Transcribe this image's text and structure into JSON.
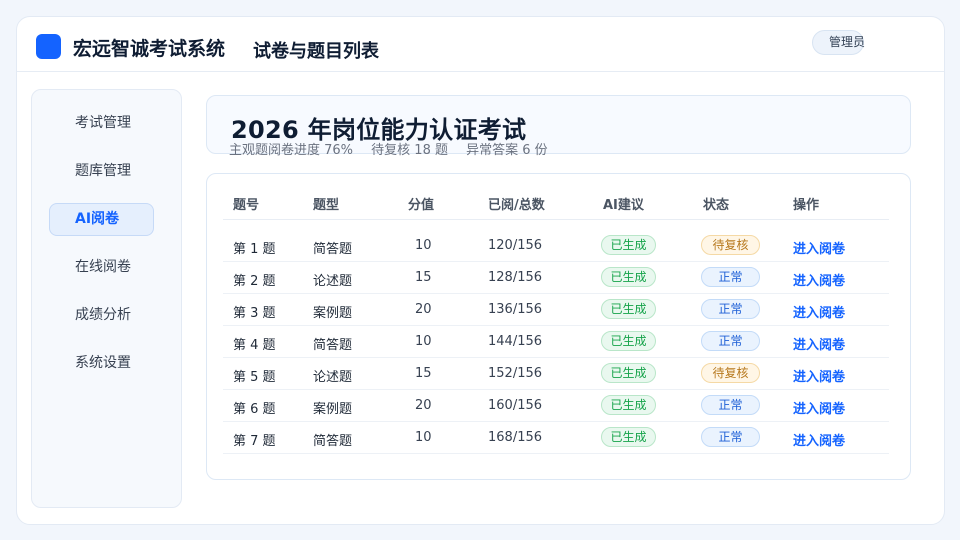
{
  "app": {
    "name": "宏远智诚考试系统",
    "page_title": "试卷与题目列表",
    "user_role": "管理员",
    "brand_color": "#1463ff"
  },
  "sidebar": {
    "items": [
      {
        "label": "考试管理",
        "active": false
      },
      {
        "label": "题库管理",
        "active": false
      },
      {
        "label": "AI阅卷",
        "active": true
      },
      {
        "label": "在线阅卷",
        "active": false
      },
      {
        "label": "成绩分析",
        "active": false
      },
      {
        "label": "系统设置",
        "active": false
      }
    ]
  },
  "exam": {
    "title": "2026 年岗位能力认证考试",
    "progress_text": "主观题阅卷进度 76%",
    "pending_text": "待复核 18 题",
    "abnormal_text": "异常答案 6 份"
  },
  "table": {
    "headers": [
      "题号",
      "题型",
      "分值",
      "已阅/总数",
      "AI建议",
      "状态",
      "操作"
    ],
    "rows": [
      {
        "no": "第 1 题",
        "type": "简答题",
        "score": "10",
        "progress": "120/156",
        "ai": "已生成",
        "status": "待复核",
        "status_kind": "wait",
        "action": "进入阅卷"
      },
      {
        "no": "第 2 题",
        "type": "论述题",
        "score": "15",
        "progress": "128/156",
        "ai": "已生成",
        "status": "正常",
        "status_kind": "ok",
        "action": "进入阅卷"
      },
      {
        "no": "第 3 题",
        "type": "案例题",
        "score": "20",
        "progress": "136/156",
        "ai": "已生成",
        "status": "正常",
        "status_kind": "ok",
        "action": "进入阅卷"
      },
      {
        "no": "第 4 题",
        "type": "简答题",
        "score": "10",
        "progress": "144/156",
        "ai": "已生成",
        "status": "正常",
        "status_kind": "ok",
        "action": "进入阅卷"
      },
      {
        "no": "第 5 题",
        "type": "论述题",
        "score": "15",
        "progress": "152/156",
        "ai": "已生成",
        "status": "待复核",
        "status_kind": "wait",
        "action": "进入阅卷"
      },
      {
        "no": "第 6 题",
        "type": "案例题",
        "score": "20",
        "progress": "160/156",
        "ai": "已生成",
        "status": "正常",
        "status_kind": "ok",
        "action": "进入阅卷"
      },
      {
        "no": "第 7 题",
        "type": "简答题",
        "score": "10",
        "progress": "168/156",
        "ai": "已生成",
        "status": "正常",
        "status_kind": "ok",
        "action": "进入阅卷"
      }
    ]
  }
}
